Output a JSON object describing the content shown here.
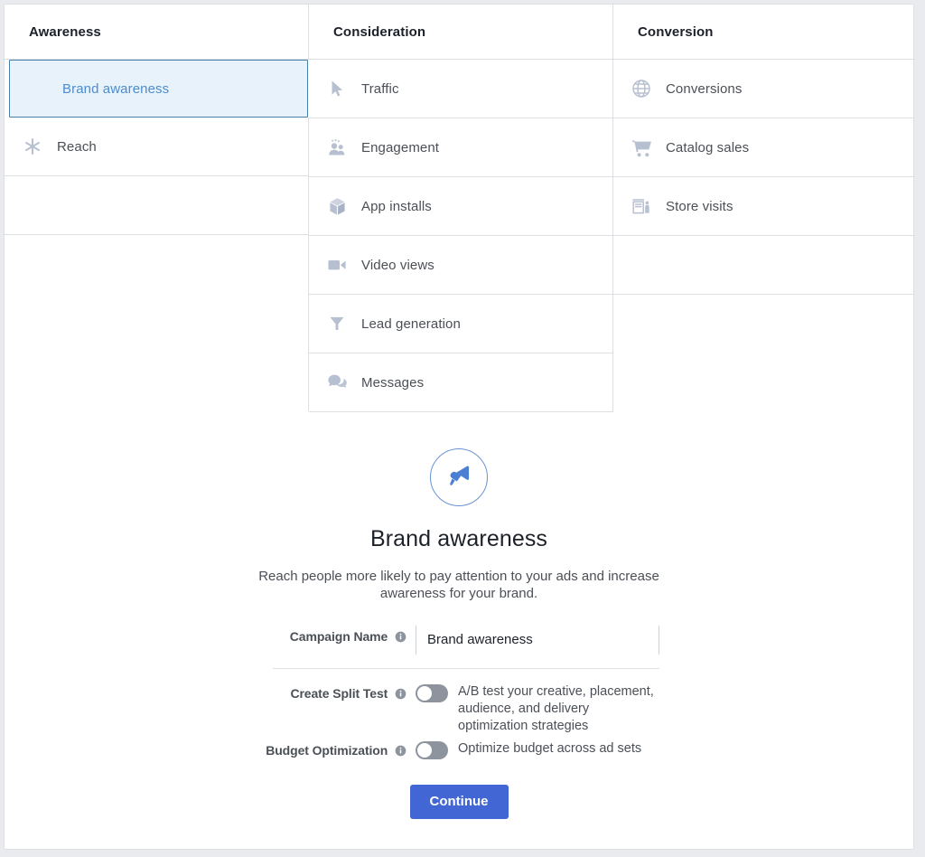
{
  "colors": {
    "accent_blue": "#4267d4",
    "selected_row_bg": "#e8f2fb",
    "selected_row_border": "#4a7fa8",
    "selected_row_text": "#4b8dcf",
    "icon_gray": "#b7c0d0",
    "border": "#dddfe2",
    "text_primary": "#1d2129",
    "text_secondary": "#4b4f56",
    "toggle_off": "#8d949e",
    "page_bg": "#e9ebee"
  },
  "objectives": {
    "columns": [
      {
        "heading": "Awareness",
        "items": [
          {
            "label": "Brand awareness",
            "icon": "megaphone-icon",
            "selected": true
          },
          {
            "label": "Reach",
            "icon": "starburst-icon",
            "selected": false
          }
        ]
      },
      {
        "heading": "Consideration",
        "items": [
          {
            "label": "Traffic",
            "icon": "cursor-icon",
            "selected": false
          },
          {
            "label": "Engagement",
            "icon": "people-icon",
            "selected": false
          },
          {
            "label": "App installs",
            "icon": "cube-icon",
            "selected": false
          },
          {
            "label": "Video views",
            "icon": "video-camera-icon",
            "selected": false
          },
          {
            "label": "Lead generation",
            "icon": "funnel-icon",
            "selected": false
          },
          {
            "label": "Messages",
            "icon": "chat-bubbles-icon",
            "selected": false
          }
        ]
      },
      {
        "heading": "Conversion",
        "items": [
          {
            "label": "Conversions",
            "icon": "globe-icon",
            "selected": false
          },
          {
            "label": "Catalog sales",
            "icon": "shopping-cart-icon",
            "selected": false
          },
          {
            "label": "Store visits",
            "icon": "storefront-icon",
            "selected": false
          }
        ]
      }
    ]
  },
  "detail": {
    "icon": "megaphone-icon",
    "title": "Brand awareness",
    "description": "Reach people more likely to pay attention to your ads and increase awareness for your brand."
  },
  "form": {
    "campaign_name": {
      "label": "Campaign Name",
      "value": "Brand awareness",
      "placeholder": "Campaign Name",
      "info_icon": "info-icon"
    },
    "split_test": {
      "label": "Create Split Test",
      "info_icon": "info-icon",
      "toggle_state": "off",
      "description": "A/B test your creative, placement, audience, and delivery optimization strategies"
    },
    "budget_optimization": {
      "label": "Budget Optimization",
      "info_icon": "info-icon",
      "toggle_state": "off",
      "description": "Optimize budget across ad sets"
    },
    "continue_label": "Continue"
  }
}
